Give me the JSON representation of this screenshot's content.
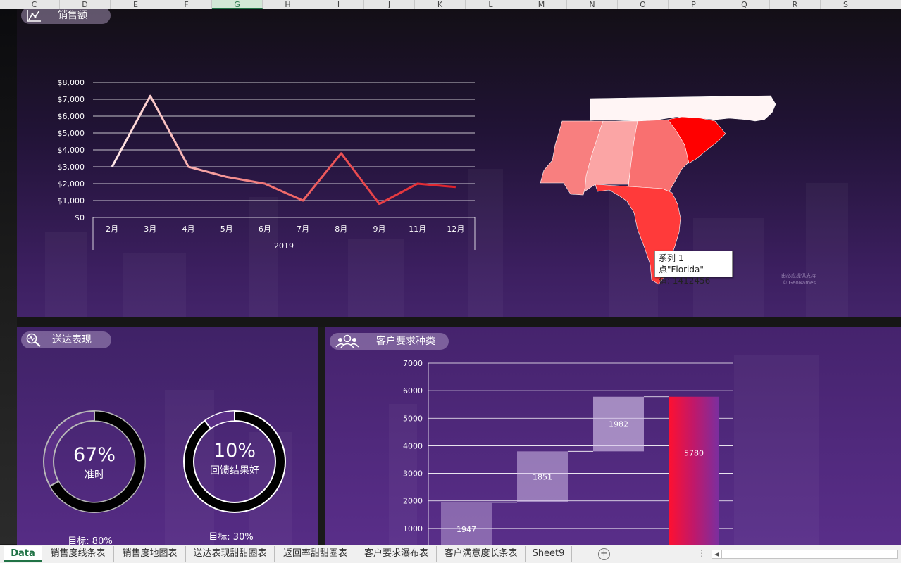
{
  "columns": [
    "C",
    "D",
    "E",
    "F",
    "G",
    "H",
    "I",
    "J",
    "K",
    "L",
    "M",
    "N",
    "O",
    "P",
    "Q",
    "R",
    "S"
  ],
  "selected_column": "G",
  "panels": {
    "sales": {
      "title": "销售额"
    },
    "delivery": {
      "title": "送达表现"
    },
    "requests": {
      "title": "客户要求种类"
    }
  },
  "map": {
    "tooltip_line1": "系列 1 点\"Florida\"",
    "tooltip_line2": "值: 1412456",
    "credit_line1": "由必应提供支持",
    "credit_line2": "© GeoNames",
    "regions": [
      {
        "name": "North Carolina",
        "color": "#fff5f5"
      },
      {
        "name": "Mississippi",
        "color": "#f87f7f"
      },
      {
        "name": "Alabama",
        "color": "#fba5a5"
      },
      {
        "name": "Georgia",
        "color": "#f97070"
      },
      {
        "name": "South Carolina",
        "color": "#ff0000"
      },
      {
        "name": "Florida",
        "color": "#ff3a3a"
      }
    ]
  },
  "donuts": [
    {
      "value_label": "67%",
      "caption": "准时",
      "fraction": 0.67,
      "target_label": "目标:  80%"
    },
    {
      "value_label": "10%",
      "caption": "回馈结果好",
      "fraction": 0.1,
      "target_label": "目标:  30%"
    }
  ],
  "chart_data": [
    {
      "type": "line",
      "categories": [
        "2月",
        "3月",
        "4月",
        "5月",
        "6月",
        "7月",
        "8月",
        "9月",
        "11月",
        "12月"
      ],
      "group_label": "2019",
      "values": [
        3000,
        7200,
        3000,
        2400,
        2000,
        1000,
        3800,
        800,
        2000,
        1800
      ],
      "ylim": [
        0,
        8000
      ],
      "yticks": [
        "$0",
        "$1,000",
        "$2,000",
        "$3,000",
        "$4,000",
        "$5,000",
        "$6,000",
        "$7,000",
        "$8,000"
      ],
      "grid": true
    },
    {
      "type": "bar",
      "subtype": "waterfall",
      "values": [
        1947,
        1851,
        1982,
        5780
      ],
      "data_labels": [
        "1947",
        "1851",
        "1982",
        "5780"
      ],
      "ylim": [
        0,
        7000
      ],
      "yticks": [
        "1000",
        "2000",
        "3000",
        "4000",
        "5000",
        "6000",
        "7000"
      ],
      "grid": true
    }
  ],
  "tabs": [
    "Data",
    "销售度线条表",
    "销售度地图表",
    "送达表现甜甜圈表",
    "返回率甜甜圈表",
    "客户要求瀑布表",
    "客户满意度长条表",
    "Sheet9"
  ],
  "active_tab": "Data",
  "colors": {
    "accent": "#217346",
    "line_start": "#ffe8e8",
    "line_end": "#e0202a"
  }
}
